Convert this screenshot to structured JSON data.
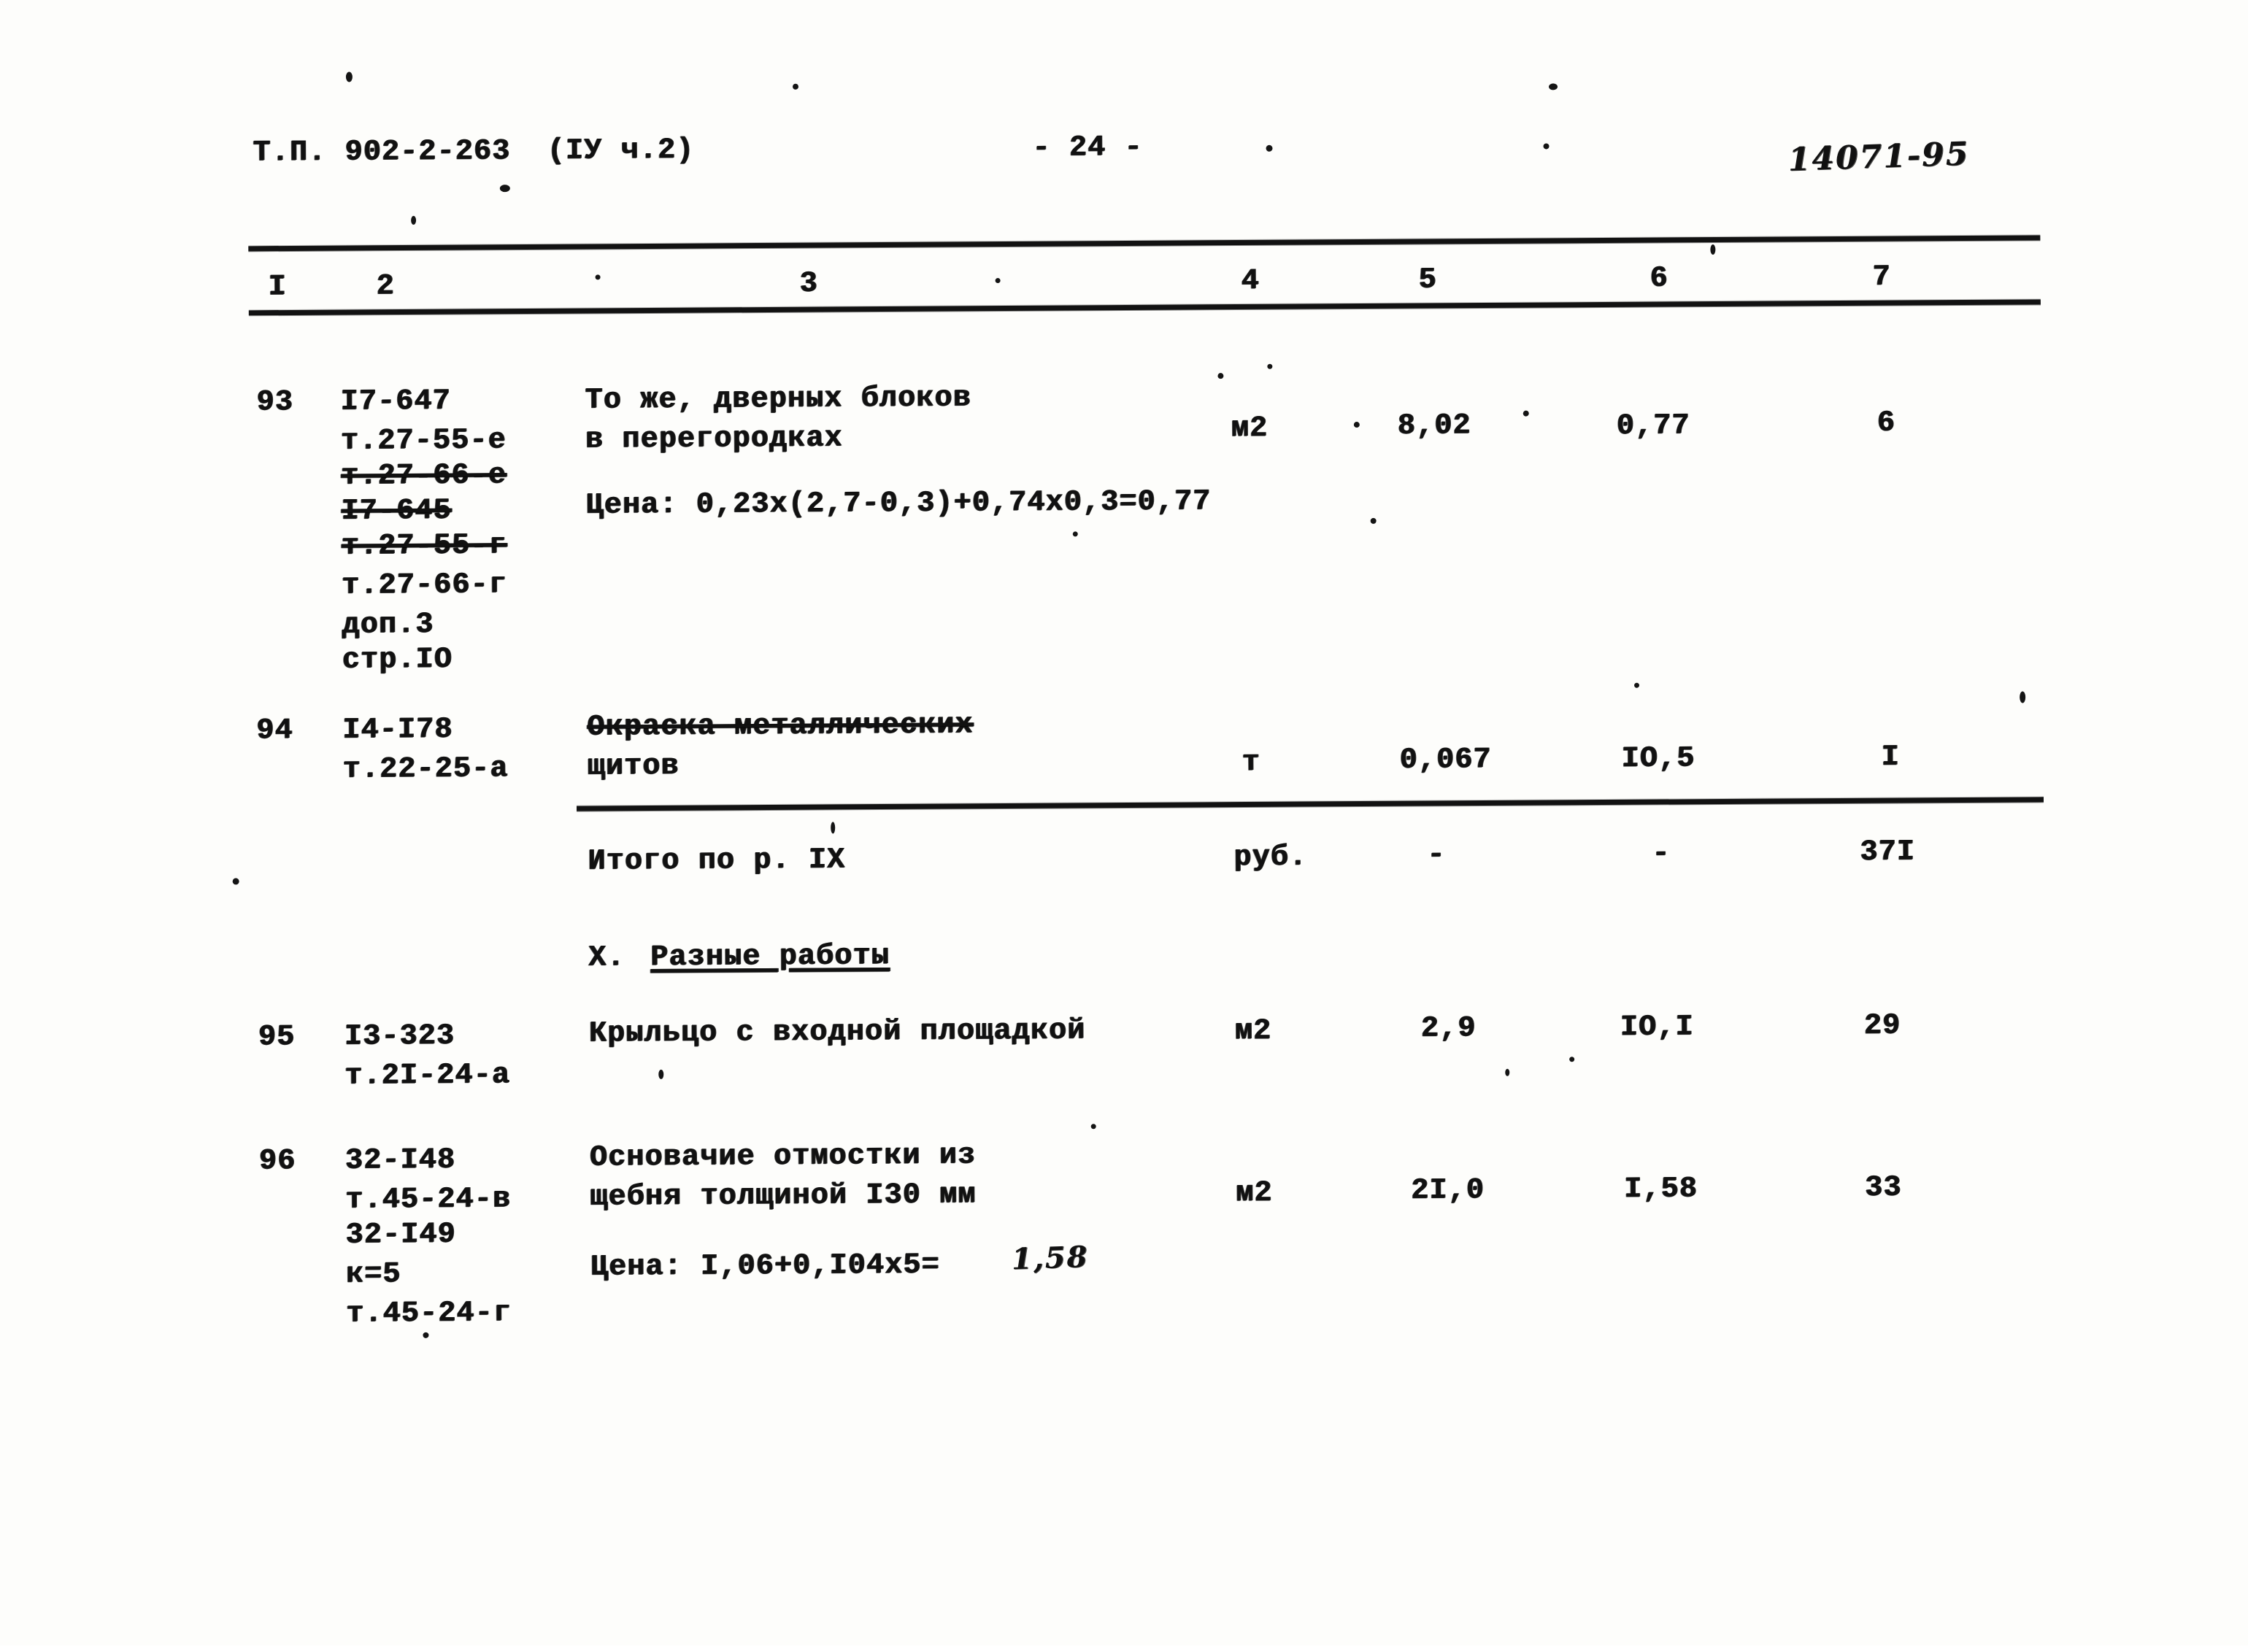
{
  "document": {
    "series_label": "Т.П. 902-2-263  (IУ ч.2)",
    "page_label": "- 24 -",
    "archive_stamp": "14071-95"
  },
  "table": {
    "column_headers": [
      "I",
      "2",
      "3",
      "4",
      "5",
      "6",
      "7"
    ],
    "rows": [
      {
        "no": "93",
        "codes": [
          "I7-647",
          "т.27-55-е",
          "т.27-66-е",
          "I7-645",
          "т.27-55-г",
          "т.27-66-г",
          "доп.3",
          "стр.IO"
        ],
        "description_lines": [
          "То же, дверных блоков",
          "в перегородках"
        ],
        "price_formula": "Цена: 0,23х(2,7-0,3)+0,74х0,3=0,77",
        "unit": "м2",
        "quantity": "8,02",
        "unit_price": "0,77",
        "total": "6"
      },
      {
        "no": "94",
        "codes": [
          "I4-I78",
          "т.22-25-а"
        ],
        "description_lines": [
          "Окраска металлических",
          "щитов"
        ],
        "price_formula": "",
        "unit": "т",
        "quantity": "0,067",
        "unit_price": "IO,5",
        "total": "I"
      }
    ],
    "subtotal": {
      "label": "Итого по р. IX",
      "unit": "руб.",
      "quantity": "-",
      "unit_price": "-",
      "total": "37I"
    },
    "section": {
      "number": "X.",
      "title": "Разные работы"
    },
    "rows2": [
      {
        "no": "95",
        "codes": [
          "I3-323",
          "т.2I-24-а"
        ],
        "description_lines": [
          "Крыльцо с входной площадкой"
        ],
        "price_formula": "",
        "unit": "м2",
        "quantity": "2,9",
        "unit_price": "IO,I",
        "total": "29"
      },
      {
        "no": "96",
        "codes": [
          "32-I48",
          "т.45-24-в",
          "32-I49",
          "к=5",
          "т.45-24-г"
        ],
        "description_lines": [
          "Основачие отмостки из",
          "щебня толщиной I30 мм"
        ],
        "price_formula_typed": "Цена: I,06+0,I04х5=",
        "price_formula_hand": "1,58",
        "unit": "м2",
        "quantity": "2I,0",
        "unit_price": "I,58",
        "total": "33"
      }
    ]
  }
}
